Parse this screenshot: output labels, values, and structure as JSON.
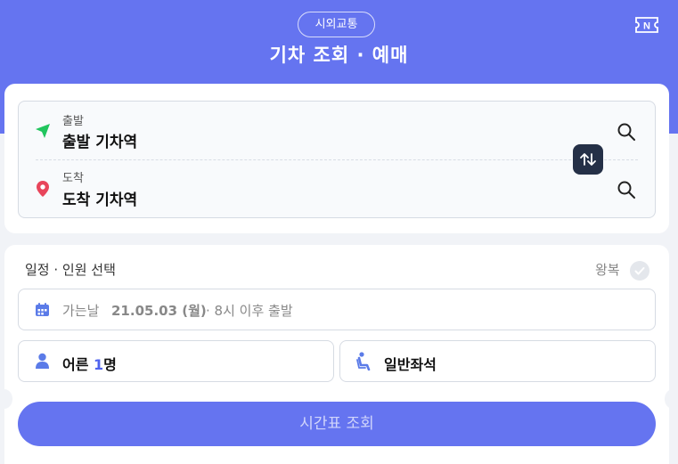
{
  "header": {
    "category": "시외교통",
    "title": "기차 조회 · 예매",
    "ticket_icon": "ticket-n-icon"
  },
  "route": {
    "departure": {
      "label": "출발",
      "placeholder": "출발 기차역",
      "icon": "navigation-arrow-icon",
      "color": "#22c55e"
    },
    "arrival": {
      "label": "도착",
      "placeholder": "도착 기차역",
      "icon": "map-pin-icon",
      "color": "#e8455b"
    },
    "swap_icon": "swap-vertical-icon",
    "search_icon": "search-icon"
  },
  "schedule": {
    "section_title": "일정 · 인원 선택",
    "roundtrip_label": "왕복",
    "date": {
      "label": "가는날",
      "value": "21.05.03 (월)",
      "suffix": "· 8시 이후 출발",
      "icon": "calendar-icon"
    },
    "passengers": {
      "prefix": "어른 ",
      "count": "1",
      "suffix": "명",
      "icon": "person-icon"
    },
    "seat": {
      "label": "일반좌석",
      "icon": "seat-icon"
    }
  },
  "submit": {
    "label": "시간표 조회"
  },
  "colors": {
    "brand": "#6574f0",
    "accent_text": "#4f63ee",
    "swap_bg": "#253047"
  }
}
